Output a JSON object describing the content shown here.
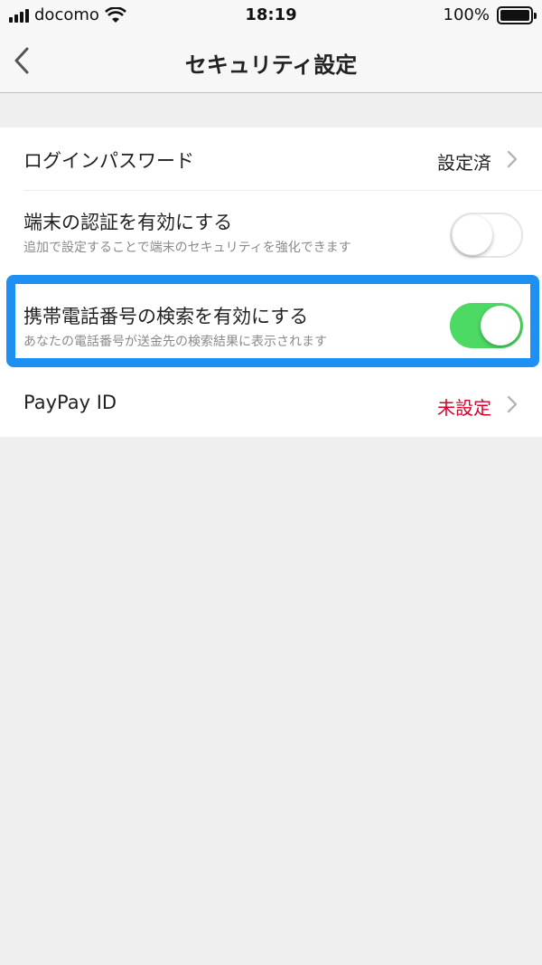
{
  "status_bar": {
    "carrier": "docomo",
    "time": "18:19",
    "battery": "100%",
    "icons": [
      "signal-icon",
      "wifi-icon",
      "battery-icon"
    ]
  },
  "nav": {
    "title": "セキュリティ設定",
    "back_icon": "chevron-left-icon"
  },
  "settings": {
    "password": {
      "title": "ログインパスワード",
      "value": "設定済"
    },
    "device_auth": {
      "title": "端末の認証を有効にする",
      "subtitle": "追加で設定することで端末のセキュリティを強化できます",
      "enabled": false
    },
    "phone_search": {
      "title": "携帯電話番号の検索を有効にする",
      "subtitle": "あなたの電話番号が送金先の検索結果に表示されます",
      "enabled": true
    },
    "paypay_id": {
      "title": "PayPay ID",
      "value": "未設定"
    }
  },
  "colors": {
    "toggle_on": "#4cd964",
    "unset_value": "#d9002b",
    "highlight_border": "#1e90f2"
  }
}
